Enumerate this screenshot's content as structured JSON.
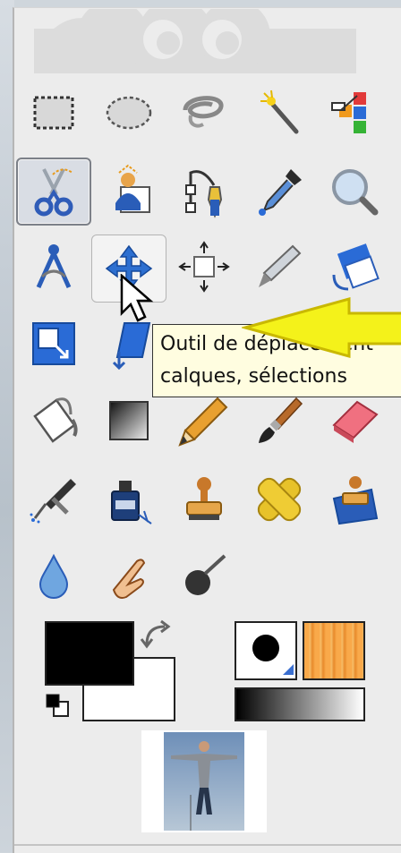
{
  "window": {
    "title": ""
  },
  "tooltip": {
    "line1": "Outil de déplacement",
    "line2": "calques, sélections"
  },
  "tools": [
    {
      "row": 0,
      "col": 0,
      "name": "rect-select",
      "icon": "rect-select-icon"
    },
    {
      "row": 0,
      "col": 1,
      "name": "ellipse-select",
      "icon": "ellipse-select-icon"
    },
    {
      "row": 0,
      "col": 2,
      "name": "free-select",
      "icon": "lasso-icon"
    },
    {
      "row": 0,
      "col": 3,
      "name": "fuzzy-select",
      "icon": "magic-wand-icon"
    },
    {
      "row": 0,
      "col": 4,
      "name": "select-by-color",
      "icon": "color-select-icon"
    },
    {
      "row": 1,
      "col": 0,
      "name": "scissors-select",
      "icon": "scissors-icon",
      "active": true
    },
    {
      "row": 1,
      "col": 1,
      "name": "foreground-select",
      "icon": "foreground-select-icon"
    },
    {
      "row": 1,
      "col": 2,
      "name": "paths",
      "icon": "paths-icon"
    },
    {
      "row": 1,
      "col": 3,
      "name": "color-picker",
      "icon": "eyedropper-icon"
    },
    {
      "row": 1,
      "col": 4,
      "name": "zoom",
      "icon": "magnifier-icon"
    },
    {
      "row": 2,
      "col": 0,
      "name": "measure",
      "icon": "compass-icon"
    },
    {
      "row": 2,
      "col": 1,
      "name": "move",
      "icon": "move-icon",
      "hover": true
    },
    {
      "row": 2,
      "col": 2,
      "name": "align",
      "icon": "align-icon"
    },
    {
      "row": 2,
      "col": 3,
      "name": "crop",
      "icon": "crop-knife-icon"
    },
    {
      "row": 2,
      "col": 4,
      "name": "rotate",
      "icon": "rotate-icon"
    },
    {
      "row": 3,
      "col": 0,
      "name": "scale",
      "icon": "scale-icon"
    },
    {
      "row": 3,
      "col": 1,
      "name": "shear",
      "icon": "shear-icon"
    },
    {
      "row": 4,
      "col": 0,
      "name": "bucket-fill",
      "icon": "bucket-icon"
    },
    {
      "row": 4,
      "col": 1,
      "name": "blend",
      "icon": "gradient-icon"
    },
    {
      "row": 4,
      "col": 2,
      "name": "pencil",
      "icon": "pencil-icon"
    },
    {
      "row": 4,
      "col": 3,
      "name": "paintbrush",
      "icon": "paintbrush-icon"
    },
    {
      "row": 4,
      "col": 4,
      "name": "eraser",
      "icon": "eraser-icon"
    },
    {
      "row": 5,
      "col": 0,
      "name": "airbrush",
      "icon": "airbrush-icon"
    },
    {
      "row": 5,
      "col": 1,
      "name": "ink",
      "icon": "ink-icon"
    },
    {
      "row": 5,
      "col": 2,
      "name": "clone",
      "icon": "stamp-icon"
    },
    {
      "row": 5,
      "col": 3,
      "name": "heal",
      "icon": "bandage-icon"
    },
    {
      "row": 5,
      "col": 4,
      "name": "perspective-clone",
      "icon": "perspective-stamp-icon"
    },
    {
      "row": 6,
      "col": 0,
      "name": "blur-sharpen",
      "icon": "drop-icon"
    },
    {
      "row": 6,
      "col": 1,
      "name": "smudge",
      "icon": "smudge-finger-icon"
    },
    {
      "row": 6,
      "col": 2,
      "name": "dodge-burn",
      "icon": "dodge-burn-icon"
    }
  ],
  "colors": {
    "foreground": "#000000",
    "background": "#ffffff",
    "window_bg": "#ececec",
    "tooltip_bg": "#fffde0",
    "annotation_arrow": "#f4f21a"
  }
}
